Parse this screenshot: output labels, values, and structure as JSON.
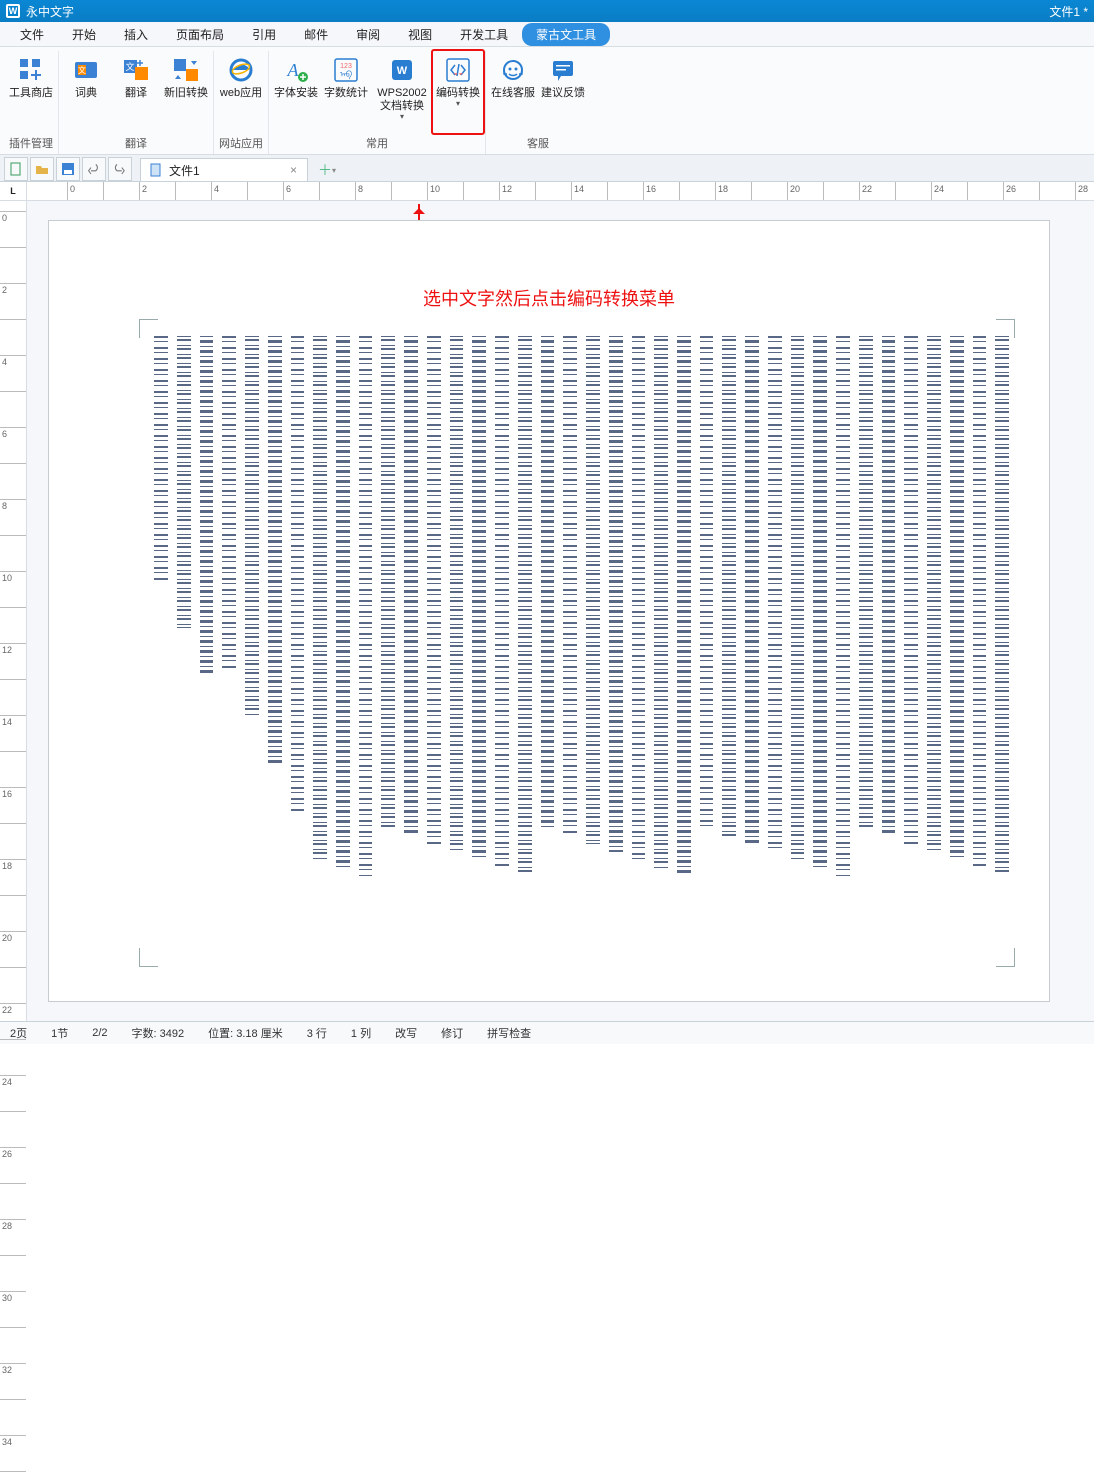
{
  "title_bar": {
    "app_name": "永中文字",
    "doc_name": "文件1 *"
  },
  "menu": {
    "items": [
      "文件",
      "开始",
      "插入",
      "页面布局",
      "引用",
      "邮件",
      "审阅",
      "视图",
      "开发工具",
      "蒙古文工具"
    ],
    "active_index": 9
  },
  "ribbon": {
    "groups": [
      {
        "title": "插件管理",
        "buttons": [
          {
            "id": "tool-store",
            "label": "工具商店"
          }
        ]
      },
      {
        "title": "翻译",
        "buttons": [
          {
            "id": "dict",
            "label": "词典"
          },
          {
            "id": "translate",
            "label": "翻译"
          },
          {
            "id": "legacy-convert",
            "label": "新旧转换"
          }
        ]
      },
      {
        "title": "网站应用",
        "buttons": [
          {
            "id": "web-app",
            "label": "web应用"
          }
        ]
      },
      {
        "title": "常用",
        "buttons": [
          {
            "id": "font-install",
            "label": "字体安装"
          },
          {
            "id": "word-count",
            "label": "字数统计"
          },
          {
            "id": "wps-convert",
            "label": "WPS2002\n文档转换",
            "dd": true
          },
          {
            "id": "encode-convert",
            "label": "编码转换",
            "dd": true,
            "hl": true
          }
        ]
      },
      {
        "title": "客服",
        "buttons": [
          {
            "id": "online-cs",
            "label": "在线客服"
          },
          {
            "id": "feedback",
            "label": "建议反馈"
          }
        ]
      }
    ]
  },
  "doc_tabs": {
    "active": "文件1"
  },
  "annotation": {
    "text": "选中文字然后点击编码转换菜单"
  },
  "status": {
    "page": "2页",
    "section": "1节",
    "page_of": "2/2",
    "wordcount": "字数: 3492",
    "position": "位置: 3.18 厘米",
    "line": "3 行",
    "column": "1 列",
    "overwrite": "改写",
    "revision": "修订",
    "spell": "拼写检查"
  }
}
